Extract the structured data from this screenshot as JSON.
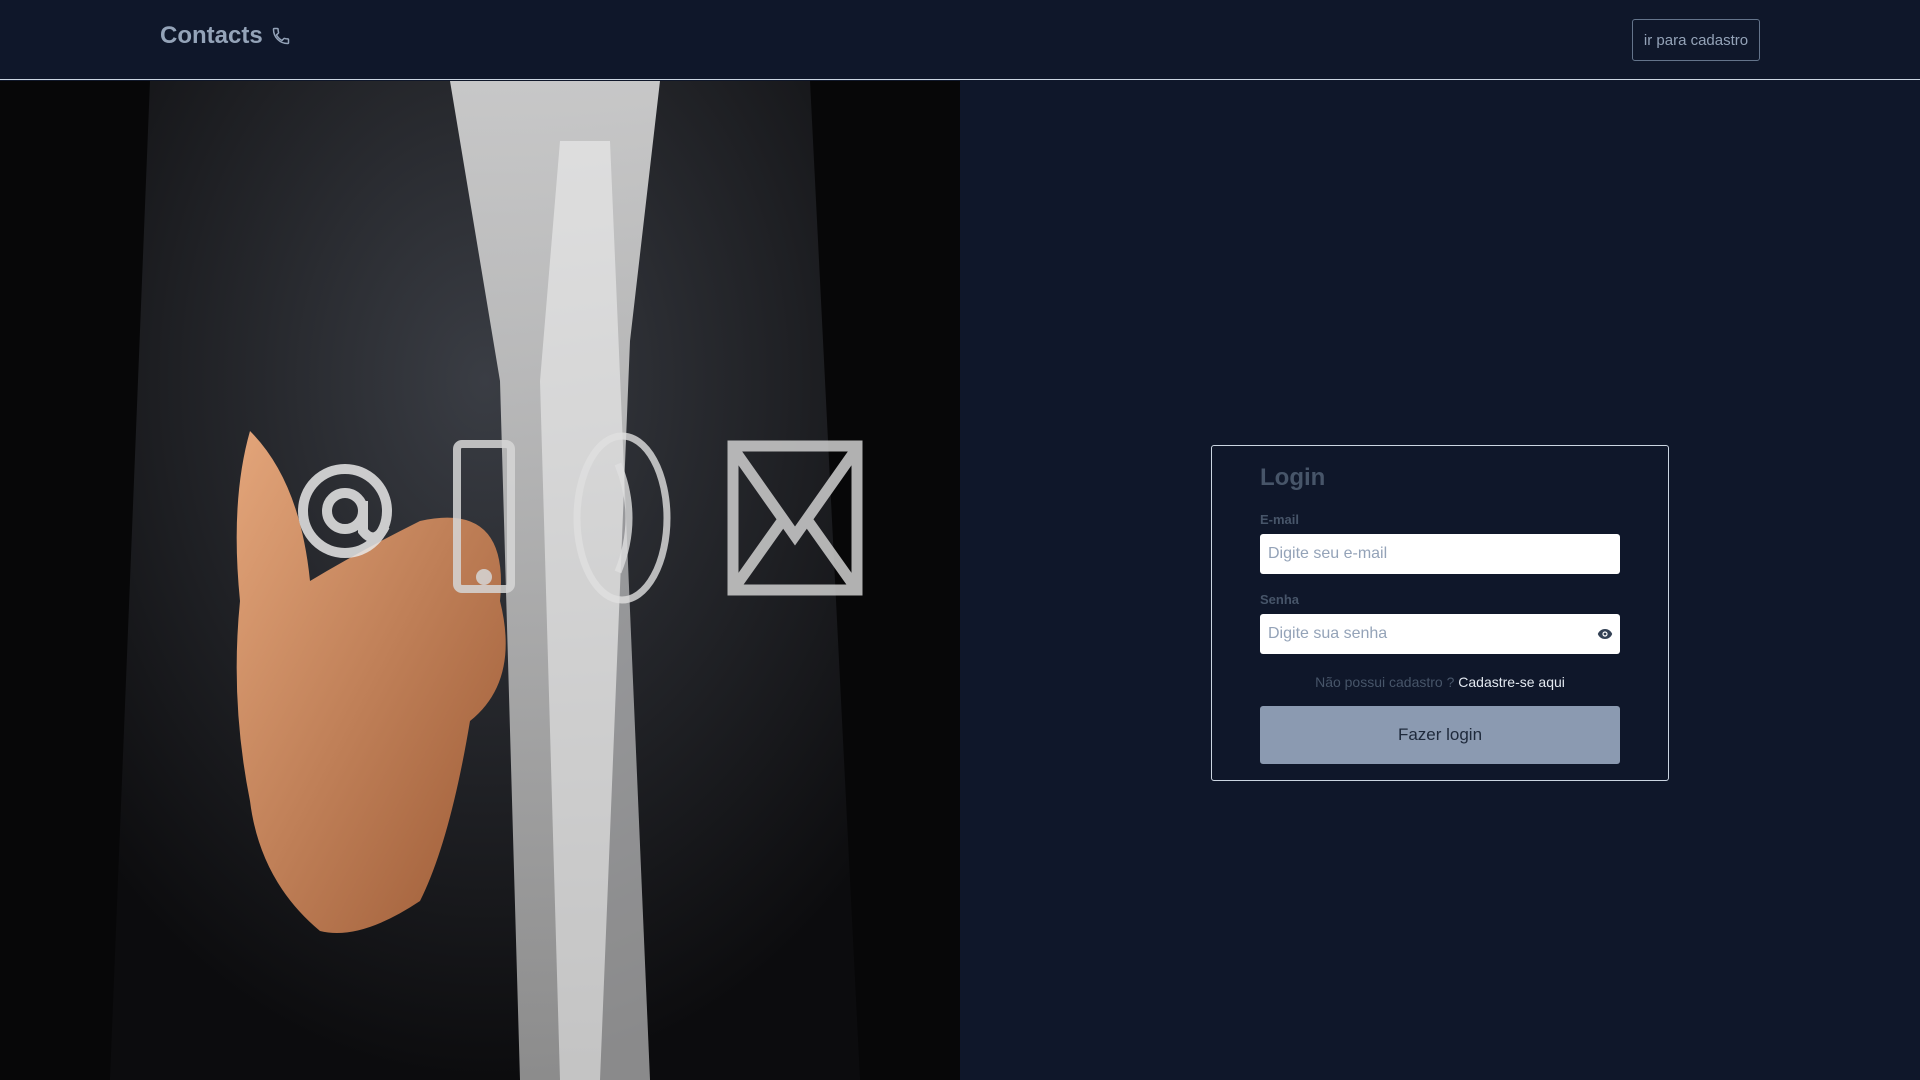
{
  "header": {
    "brand": "Contacts",
    "brand_icon": "phone-icon",
    "register_button": "ir para cadastro"
  },
  "hero": {
    "icons": [
      "at-sign-icon",
      "smartphone-icon",
      "phone-handset-icon",
      "envelope-icon"
    ]
  },
  "login": {
    "title": "Login",
    "email_label": "E-mail",
    "email_placeholder": "Digite seu e-mail",
    "email_value": "",
    "password_label": "Senha",
    "password_placeholder": "Digite sua senha",
    "password_value": "",
    "password_toggle_icon": "eye-icon",
    "signup_prompt": "Não possui cadastro ?",
    "signup_link": "Cadastre-se aqui",
    "submit_label": "Fazer login"
  },
  "colors": {
    "background": "#0f172a",
    "text_muted": "#475569",
    "button": "#8b9ab1"
  }
}
